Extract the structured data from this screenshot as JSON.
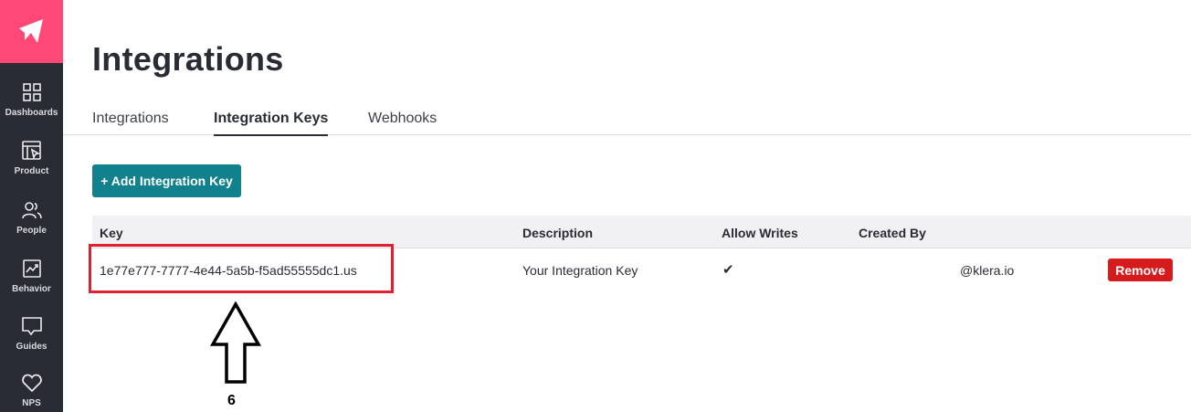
{
  "sidebar": {
    "items": [
      {
        "label": "Dashboards",
        "icon": "grid-icon"
      },
      {
        "label": "Product",
        "icon": "cursor-window-icon"
      },
      {
        "label": "People",
        "icon": "people-icon"
      },
      {
        "label": "Behavior",
        "icon": "chart-icon"
      },
      {
        "label": "Guides",
        "icon": "message-icon"
      },
      {
        "label": "NPS",
        "icon": "heart-icon"
      }
    ]
  },
  "page": {
    "title": "Integrations"
  },
  "tabs": [
    {
      "label": "Integrations",
      "active": false
    },
    {
      "label": "Integration Keys",
      "active": true
    },
    {
      "label": "Webhooks",
      "active": false
    }
  ],
  "toolbar": {
    "add_label": "+ Add Integration Key"
  },
  "table": {
    "headers": [
      "Key",
      "Description",
      "Allow Writes",
      "Created By"
    ],
    "rows": [
      {
        "key": "1e77e777-7777-4e44-5a5b-f5ad55555dc1.us",
        "description": "Your Integration Key",
        "allow_writes": "✔",
        "created_by": "@klera.io",
        "action": "Remove"
      }
    ]
  },
  "annotation": {
    "number": "6"
  },
  "colors": {
    "sidebar": "#2a2c35",
    "logo": "#ff4876",
    "primary_button": "#12818e",
    "danger_button": "#d51b1b",
    "highlight": "#e0202e"
  }
}
